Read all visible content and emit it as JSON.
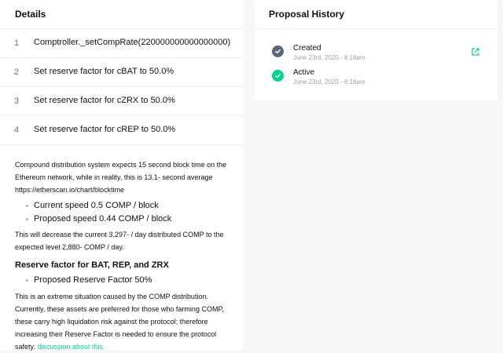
{
  "details": {
    "title": "Details",
    "actions": [
      {
        "num": "1",
        "text": "Comptroller._setCompRate(220000000000000000)"
      },
      {
        "num": "2",
        "text": "Set reserve factor for cBAT to 50.0%"
      },
      {
        "num": "3",
        "text": "Set reserve factor for cZRX to 50.0%"
      },
      {
        "num": "4",
        "text": "Set reserve factor for cREP to 50.0%"
      }
    ],
    "description": {
      "para1": "Compound distribution system expects 15 second block time on the Ethereum network, while in reality, this is 13.1- second average https://etherscan.io/chart/blocktime",
      "bullets1": [
        "Current speed 0.5 COMP / block",
        "Proposed speed 0.44 COMP / block"
      ],
      "para2": "This will decrease the current 3,297- / day distributed COMP to the expected level 2,880- COMP / day.",
      "subheading": "Reserve factor for BAT, REP, and ZRX",
      "bullets2": [
        "Proposed Reserve Factor 50%"
      ],
      "para3": "This is an extreme situation caused by the COMP distribution. Currently, these assets are preferred for those who farming COMP, these carry high liquidation risk against the protocol; therefore increasing their Reserve Factor is needed to ensure the protocol safety.",
      "link_text": "discussion about this."
    }
  },
  "history": {
    "title": "Proposal History",
    "steps": [
      {
        "label": "Created",
        "date": "June 23rd, 2020 - 8:18am",
        "status_color": "#5c6775"
      },
      {
        "label": "Active",
        "date": "June 23rd, 2020 - 8:18am",
        "status_color": "#00d395"
      }
    ]
  },
  "colors": {
    "accent": "#00d395",
    "muted": "#6b7380"
  }
}
